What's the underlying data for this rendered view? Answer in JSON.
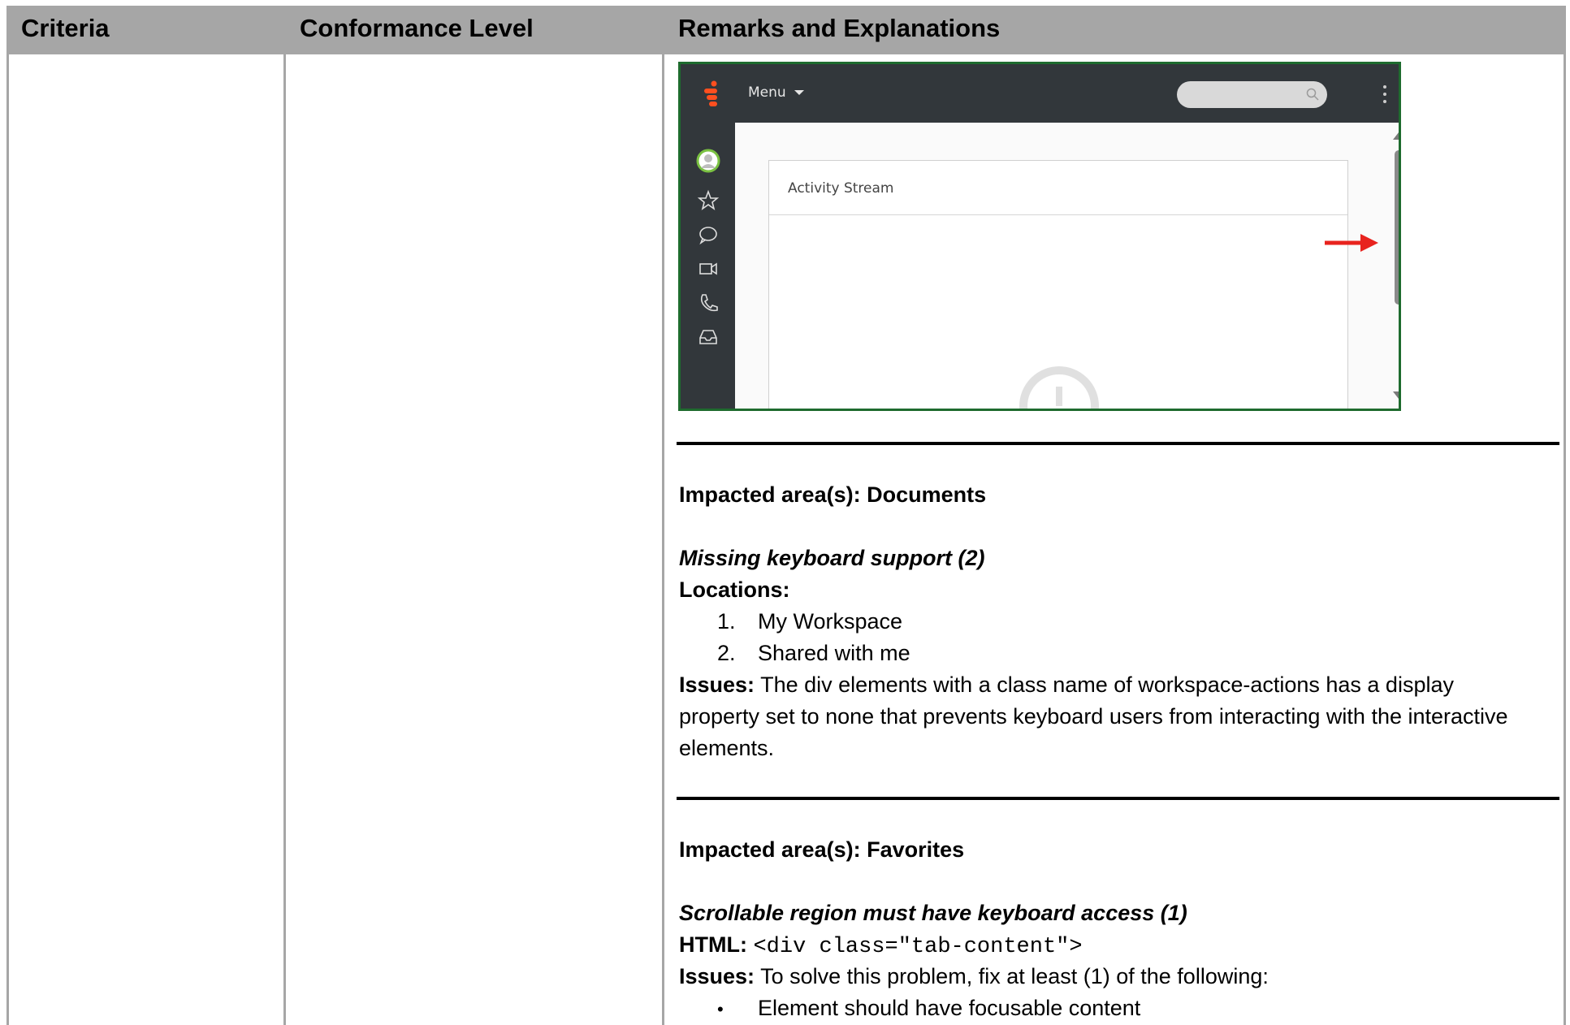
{
  "table": {
    "headers": [
      "Criteria",
      "Conformance Level",
      "Remarks and Explanations"
    ]
  },
  "screenshot": {
    "menu_label": "Menu",
    "card_title": "Activity Stream",
    "colors": {
      "frame": "#1e6b2e",
      "topbar": "#32373b",
      "logo": "#ff4f1f",
      "arrow": "#e8231e",
      "avatar_ring": "#7ac142"
    },
    "icons": [
      "logo-icon",
      "caret-down-icon",
      "search-icon",
      "kebab-icon",
      "avatar-icon",
      "star-icon",
      "chat-icon",
      "video-icon",
      "phone-icon",
      "inbox-icon",
      "clock-icon",
      "arrow-right-icon"
    ]
  },
  "section1": {
    "impacted_label": "Impacted area(s): Documents",
    "issue_title": "Missing keyboard support (2)",
    "locations_label": "Locations:",
    "locations": [
      "My Workspace",
      "Shared with me"
    ],
    "issues_label": "Issues:",
    "issues_text": "The div elements with a class name of workspace-actions has a display property set to none that prevents keyboard users from interacting with the interactive elements."
  },
  "section2": {
    "impacted_label": "Impacted area(s): Favorites",
    "issue_title": "Scrollable region must have keyboard access (1)",
    "html_label": "HTML:",
    "html_code": "<div class=\"tab-content\">",
    "issues_label": "Issues:",
    "issues_text": "To solve this problem, fix at least (1) of the following:",
    "bullets": [
      "Element should have focusable content"
    ]
  }
}
